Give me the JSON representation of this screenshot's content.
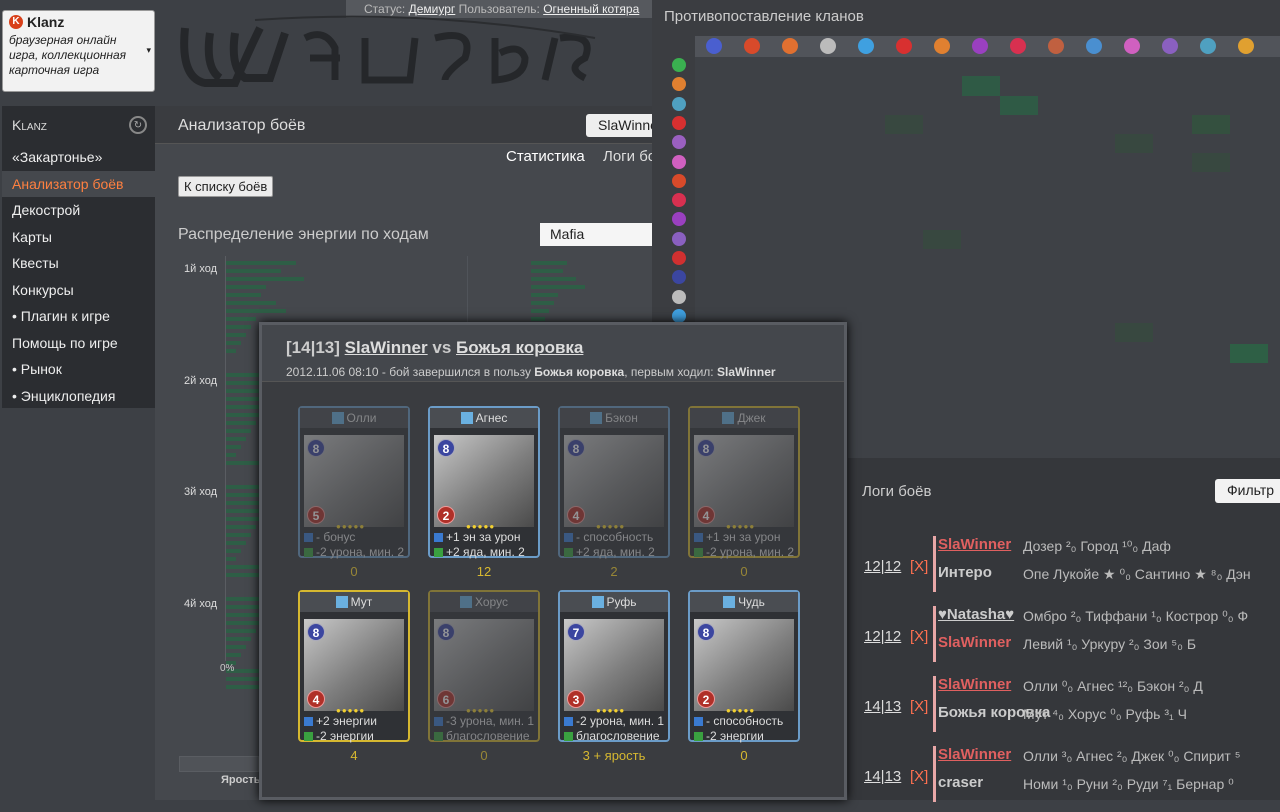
{
  "widget": {
    "title": "Klanz",
    "description": "браузерная онлайн игра, коллекционная карточная игра"
  },
  "status": {
    "status_label": "Статус:",
    "status_value": "Демиург",
    "user_label": "Пользователь:",
    "user_value": "Огненный котяра"
  },
  "menu": {
    "header": "Klanz",
    "items": [
      {
        "label": "«Закартонье»"
      },
      {
        "label": "Анализатор боёв",
        "active": true
      },
      {
        "label": "Декострой"
      },
      {
        "label": "Карты"
      },
      {
        "label": "Квесты"
      },
      {
        "label": "Конкурсы"
      },
      {
        "label": "• Плагин к игре"
      },
      {
        "label": "Помощь по игре"
      },
      {
        "label": "• Рынок"
      },
      {
        "label": "• Энциклопедия"
      }
    ]
  },
  "main": {
    "title": "Анализатор боёв",
    "player": "SlaWinner",
    "tabs": [
      "Статистика",
      "Логи боёв"
    ],
    "back_button": "К списку боёв",
    "energy_title": "Распределение энергии по ходам",
    "clan_select": "Mafia",
    "turns": [
      "1й ход",
      "2й ход",
      "3й ход",
      "4й ход"
    ],
    "axis_zero": "0%",
    "jarost": "Ярость"
  },
  "matrix": {
    "title": "Противопоставление кланов",
    "head_colors": [
      "#4a5fcf",
      "#d84a2a",
      "#e07030",
      "#bbbbbb",
      "#3fa0e0",
      "#d83030",
      "#e08030",
      "#9a40c0",
      "#d83050",
      "#c06040",
      "#4a8fd0",
      "#d060c0",
      "#8a60c0",
      "#4fa0c0",
      "#e0a030"
    ],
    "row_colors": [
      "#3ab050",
      "#e08030",
      "#4fa0c0",
      "#d83030",
      "#9a60c0",
      "#d060c0",
      "#d84a2a",
      "#d83050",
      "#9a40c0",
      "#8a60c0",
      "#d03030",
      "#3b46a0",
      "#bbbbbb",
      "#3fa0e0"
    ]
  },
  "logs": {
    "title": "Логи боёв",
    "filter": "Фильтр",
    "rows": [
      {
        "score": "12|12",
        "x": "[X]",
        "p1": "SlaWinner",
        "p2": "Интеро",
        "c1": "Дозер ²₀   Город ¹⁰₀   Даф",
        "c2": "Опе Лукойе ★ ⁰₀ Сантино ★ ⁸₀ Дэн"
      },
      {
        "score": "12|12",
        "x": "[X]",
        "p1": "♥Natasha♥",
        "p2": "SlaWinner",
        "c1": "Омбро ²₀ Тиффани ¹₀ Кострoр ⁰₀ Ф",
        "c2": "Левий ¹₀ Уркуру ²₀  Зои ⁵₀  Б"
      },
      {
        "score": "14|13",
        "x": "[X]",
        "p1": "SlaWinner",
        "p2": "Божья коровка",
        "c1": "Олли ⁰₀ Агнес ¹²₀ Бэкон ²₀ Д",
        "c2": "Мут ⁴₀  Хорус ⁰₀  Руфь ³₁ Ч"
      },
      {
        "score": "14|13",
        "x": "[X]",
        "p1": "SlaWinner",
        "p2": "craser",
        "c1": "Олли ³₀ Агнес ²₀ Джек ⁰₀ Спирит ⁵",
        "c2": "Номи ¹₀ Руни ²₀  Руди ⁷₁ Бернар ⁰"
      }
    ]
  },
  "battle": {
    "score": "[14|13]",
    "p1": "SlaWinner",
    "vs": "vs",
    "p2": "Божья коровка",
    "sub_pre": "2012.11.06 08:10 - бой завершился в пользу",
    "winner": "Божья коровка",
    "sub_mid": ", первым ходил:",
    "first": "SlaWinner",
    "cards": [
      {
        "name": "Олли",
        "lvl": "8",
        "hp": "5",
        "a1": "- бонус",
        "a2": "-2 урона, мин. 2",
        "val": "0",
        "dim": true,
        "gold": false
      },
      {
        "name": "Агнес",
        "lvl": "8",
        "hp": "2",
        "a1": "+1 эн за урон",
        "a2": "+2 яда, мин. 2",
        "val": "12",
        "dim": false,
        "gold": false
      },
      {
        "name": "Бэкон",
        "lvl": "8",
        "hp": "4",
        "a1": "- способность",
        "a2": "+2 яда, мин. 2",
        "val": "2",
        "dim": true,
        "gold": false
      },
      {
        "name": "Джек",
        "lvl": "8",
        "hp": "4",
        "a1": "+1 эн за урон",
        "a2": "-2 урона, мин. 2",
        "val": "0",
        "dim": true,
        "gold": true
      },
      {
        "name": "Мут",
        "lvl": "8",
        "hp": "4",
        "a1": "+2 энергии",
        "a2": "-2 энергии",
        "val": "4",
        "dim": false,
        "gold": true
      },
      {
        "name": "Хорус",
        "lvl": "8",
        "hp": "6",
        "a1": "-3 урона, мин. 1",
        "a2": "благословение",
        "val": "0",
        "dim": true,
        "gold": true
      },
      {
        "name": "Руфь",
        "lvl": "7",
        "hp": "3",
        "a1": "-2 урона, мин. 1",
        "a2": "благословение",
        "val": "3 + ярость",
        "dim": false,
        "gold": false
      },
      {
        "name": "Чудь",
        "lvl": "8",
        "hp": "2",
        "a1": "- способность",
        "a2": "-2 энергии",
        "val": "0",
        "dim": false,
        "gold": false
      }
    ]
  }
}
